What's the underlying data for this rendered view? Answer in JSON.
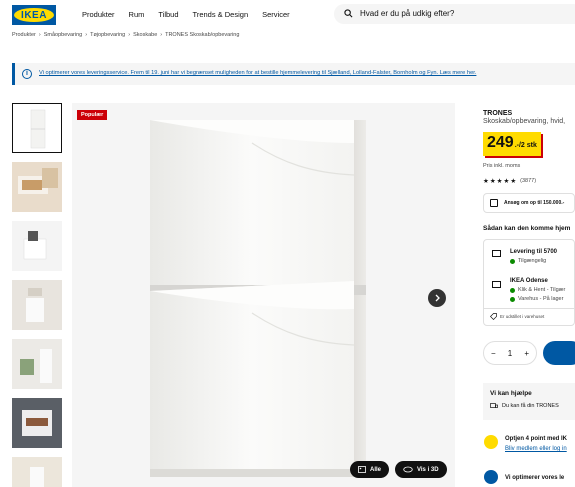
{
  "header": {
    "logo_text": "IKEA",
    "nav": [
      "Produkter",
      "Rum",
      "Tilbud",
      "Trends & Design",
      "Servicer"
    ],
    "search_placeholder": "Hvad er du på udkig efter?"
  },
  "breadcrumb": [
    "Produkter",
    "Småopbevaring",
    "Tøjopbevaring",
    "Skoskabe",
    "TRONES Skoskab/opbevaring"
  ],
  "banner": {
    "icon": "info-icon",
    "text": "Vi optimerer vores leveringsservice. Frem til 19. juni har vi begrænset muligheden for at bestille hjemmelevering til Sjælland, Lolland-Falster, Bornholm og Fyn. Læs mere her."
  },
  "gallery": {
    "badge": "Populær",
    "thumbnails_count": 7,
    "buttons": {
      "all": "Alle",
      "view3d": "Vis i 3D"
    }
  },
  "product": {
    "name": "TRONES",
    "description": "Skoskab/opbevaring, hvid, ",
    "price_main": "249",
    "price_suffix": ".-/2 stk",
    "price_note": "Pris inkl. moms",
    "rating_stars": 4.5,
    "rating_count": "(3877)",
    "finance_text": "Ansøg om op til 150.000.-"
  },
  "availability": {
    "title": "Sådan kan den komme hjem",
    "delivery_title": "Levering til 5700",
    "delivery_status": "Tilgængelig",
    "store_title": "IKEA Odense",
    "store_line1": "Klik & Hent - Tilgær",
    "store_line2": "Varehus - På lager",
    "footer": "Er udstillet i varehuset"
  },
  "quantity": {
    "minus": "−",
    "value": "1",
    "plus": "+"
  },
  "help": {
    "title": "Vi kan hjælpe",
    "line": "Du kan få din TRONES"
  },
  "family": {
    "title": "Optjen 4 point med IK",
    "link": "Bliv medlem eller log in",
    "title2": "Vi optimerer vores le"
  },
  "colors": {
    "ikea_blue": "#0058a3",
    "ikea_yellow": "#ffdb00",
    "badge_red": "#cc0008",
    "stock_green": "#0a8a00"
  }
}
